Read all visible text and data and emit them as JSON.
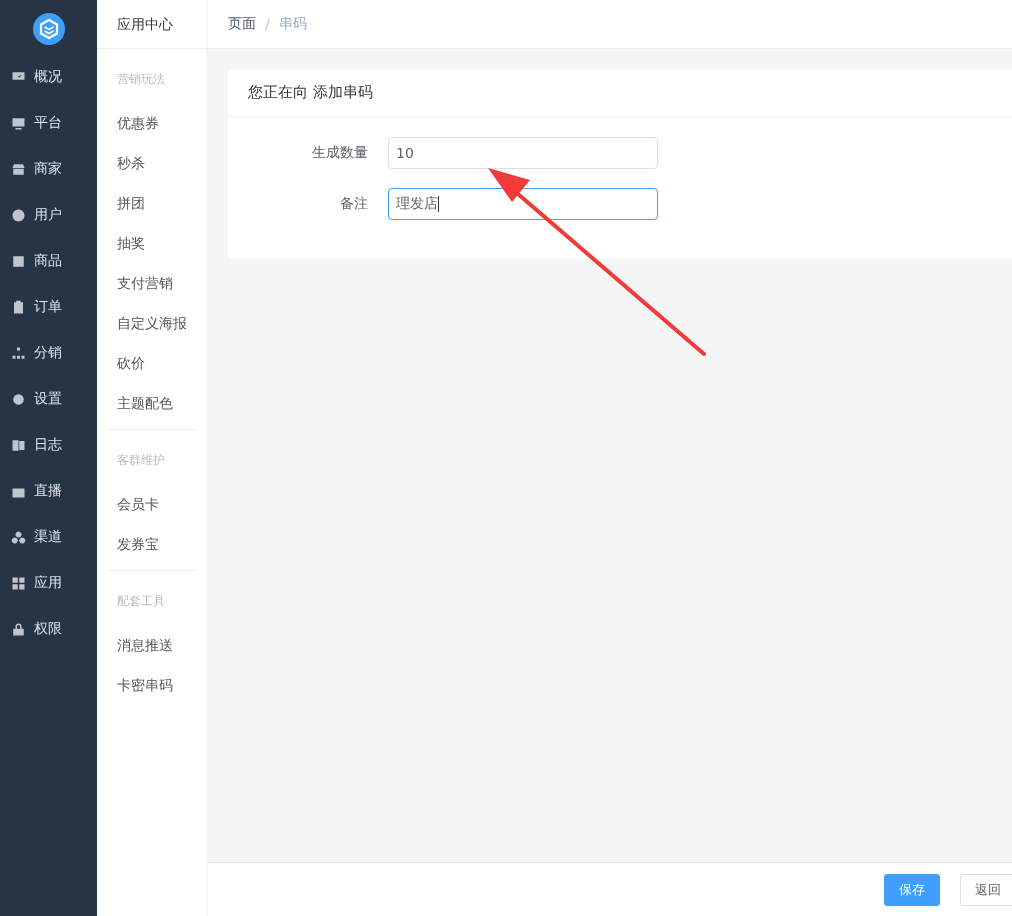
{
  "nav": [
    {
      "label": "概况"
    },
    {
      "label": "平台"
    },
    {
      "label": "商家"
    },
    {
      "label": "用户"
    },
    {
      "label": "商品"
    },
    {
      "label": "订单"
    },
    {
      "label": "分销"
    },
    {
      "label": "设置"
    },
    {
      "label": "日志"
    },
    {
      "label": "直播"
    },
    {
      "label": "渠道"
    },
    {
      "label": "应用"
    },
    {
      "label": "权限"
    }
  ],
  "submenu": {
    "title": "应用中心",
    "groups": [
      {
        "title": "营销玩法",
        "items": [
          "优惠券",
          "秒杀",
          "拼团",
          "抽奖",
          "支付营销",
          "自定义海报",
          "砍价",
          "主题配色"
        ]
      },
      {
        "title": "客群维护",
        "items": [
          "会员卡",
          "发券宝"
        ]
      },
      {
        "title": "配套工具",
        "items": [
          "消息推送",
          "卡密串码"
        ]
      }
    ]
  },
  "breadcrumb": {
    "items": [
      "页面",
      "串码"
    ],
    "separator": "/"
  },
  "card": {
    "title": "您正在向 添加串码",
    "fields": [
      {
        "label": "生成数量",
        "value": "10",
        "focused": false
      },
      {
        "label": "备注",
        "value": "理发店",
        "focused": true
      }
    ]
  },
  "footer": {
    "buttons": [
      {
        "label": "保存",
        "kind": "primary"
      },
      {
        "label": "返回",
        "kind": "default"
      }
    ]
  }
}
